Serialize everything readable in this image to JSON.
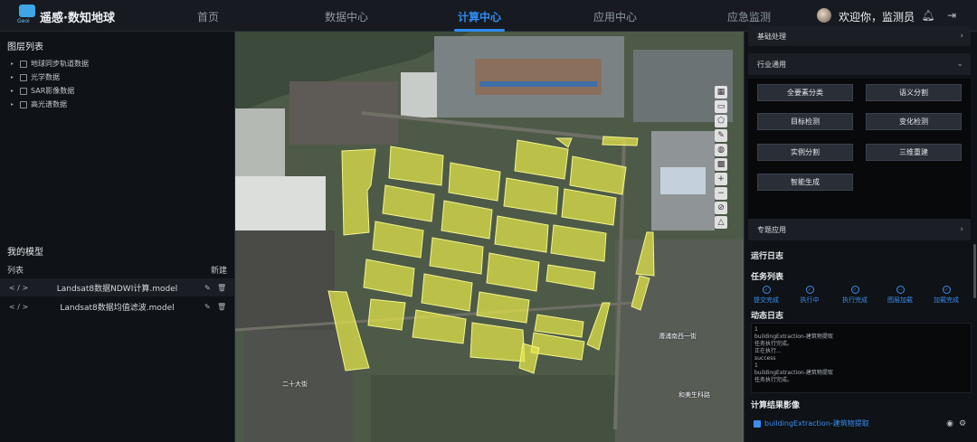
{
  "header": {
    "app_title": "遥感·数知地球",
    "logo_text": "Geoi",
    "nav": [
      "首页",
      "数据中心",
      "计算中心",
      "应用中心",
      "应急监测"
    ],
    "active_nav": "计算中心",
    "welcome": "欢迎你，监测员",
    "icons": [
      "bell-icon",
      "logout-icon"
    ]
  },
  "left": {
    "layer_title": "图层列表",
    "layers": [
      "地球同步轨道数据",
      "光学数据",
      "SAR影像数据",
      "高光谱数据"
    ],
    "models_title": "我的模型",
    "list_label": "列表",
    "new_label": "新建",
    "models": [
      "Landsat8数据NDWI计算.model",
      "Landsat8数据均值滤波.model"
    ]
  },
  "map": {
    "labels": [
      "漕浦南西一街",
      "二十大街",
      "和美生科路"
    ]
  },
  "right": {
    "acc_basic": "基础处理",
    "acc_industry": "行业通用",
    "buttons": [
      "全要素分类",
      "语义分割",
      "目标检测",
      "变化检测",
      "实例分割",
      "三维重建",
      "智能生成"
    ],
    "acc_special": "专题应用",
    "run_log_title": "运行日志",
    "task_list_title": "任务列表",
    "tasks": [
      "提交完成",
      "执行中",
      "执行完成",
      "图层加载",
      "加载完成"
    ],
    "dynamic_log_title": "动态日志",
    "log_lines": [
      "1",
      "buildingExtraction-建筑物提取",
      "任务执行完成。",
      "正在执行...",
      "success",
      "1",
      "buildingExtraction-建筑物提取",
      "任务执行完成。"
    ],
    "result_title": "计算结果影像",
    "result_item": "buildingExtraction-建筑物提取"
  },
  "colors": {
    "accent": "#2f8cf2",
    "panel": "#0f1216",
    "building_fill": "#e6e84a"
  }
}
